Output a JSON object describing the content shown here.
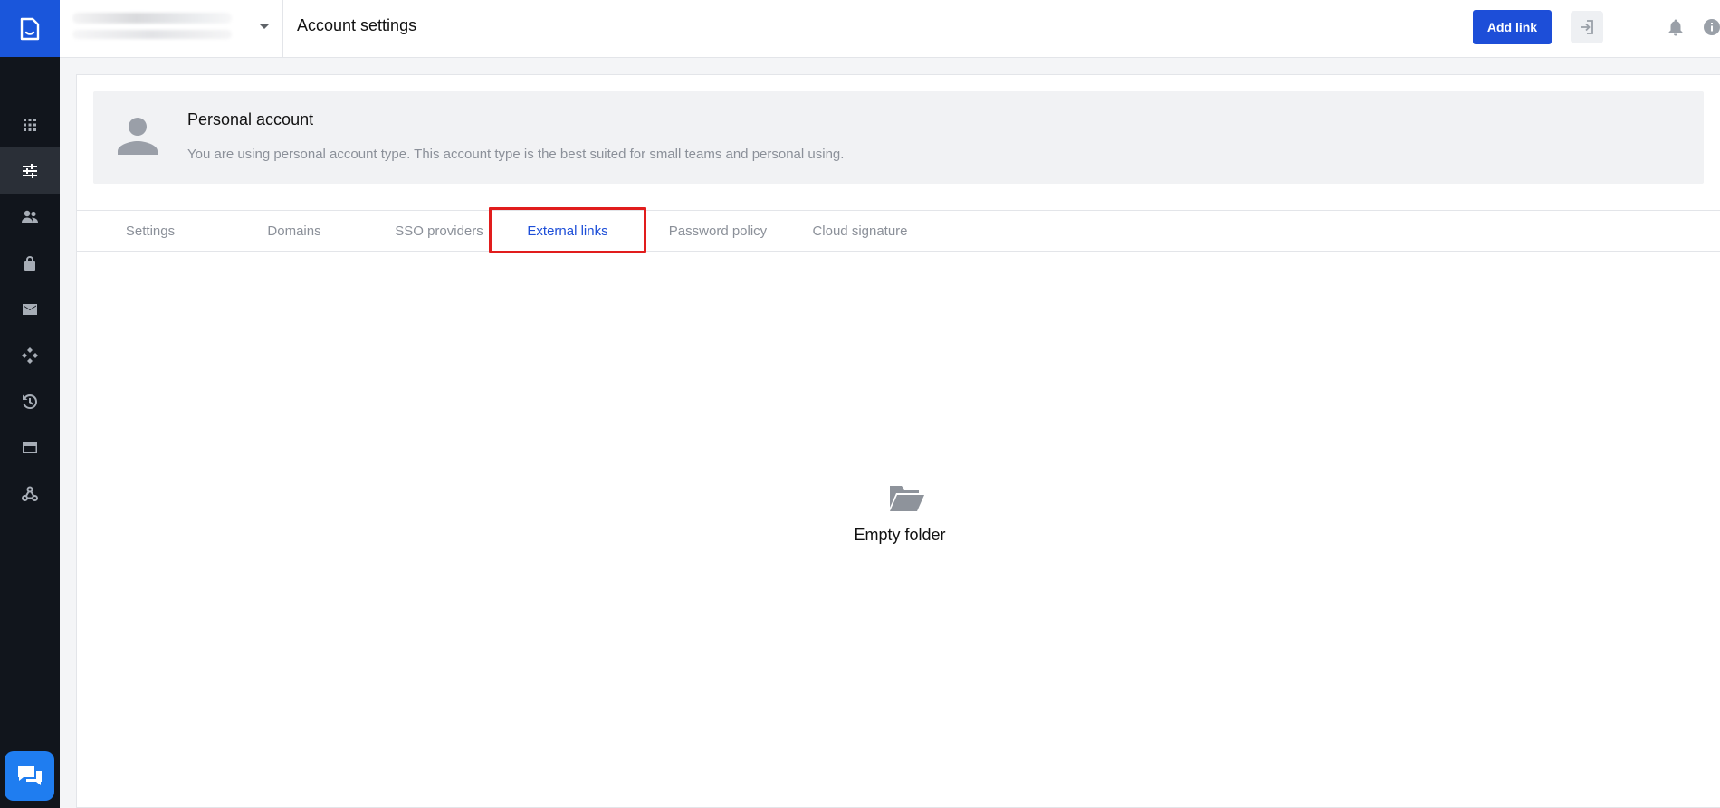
{
  "header": {
    "title": "Account settings",
    "add_link_label": "Add link"
  },
  "account": {
    "title": "Personal account",
    "description": "You are using personal account type. This account type is the best suited for small teams and personal using."
  },
  "tabs": [
    {
      "label": "Settings"
    },
    {
      "label": "Domains"
    },
    {
      "label": "SSO providers"
    },
    {
      "label": "External links",
      "active": true
    },
    {
      "label": "Password policy"
    },
    {
      "label": "Cloud signature"
    }
  ],
  "empty": {
    "text": "Empty folder",
    "icon": "open-folder-icon"
  },
  "sidebar": {
    "items": [
      {
        "icon": "apps-grid-icon"
      },
      {
        "icon": "sliders-icon",
        "active": true
      },
      {
        "icon": "people-icon"
      },
      {
        "icon": "lock-icon"
      },
      {
        "icon": "mail-icon"
      },
      {
        "icon": "diamond-nodes-icon"
      },
      {
        "icon": "history-icon"
      },
      {
        "icon": "credit-card-icon"
      },
      {
        "icon": "webhook-icon"
      }
    ]
  },
  "colors": {
    "brand": "#1a56db",
    "sidebar_bg": "#11151c",
    "active_tab": "#1d4ed8",
    "highlight_box": "#e11d1d"
  }
}
